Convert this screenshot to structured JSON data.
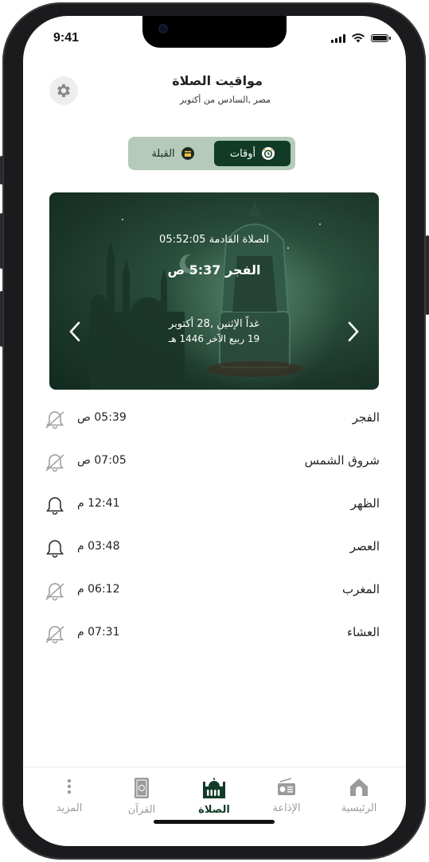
{
  "status": {
    "time": "9:41"
  },
  "header": {
    "title": "مواقيت الصلاة",
    "subtitle": "مصر ,السادس من أكتوبر"
  },
  "toggle": {
    "active_label": "أوقات",
    "inactive_label": "القبلة"
  },
  "banner": {
    "next_prayer": "الصلاة القادمة 05:52:05",
    "prayer_name": "الفجر",
    "prayer_time": "5:37 ص",
    "gregorian_date": "غداً الإثنين ,28 أكتوبر",
    "hijri_date": "19 ربيع الآخر 1446 هـ"
  },
  "prayers": [
    {
      "name": "الفجر",
      "time": "05:39 ص",
      "notify": false
    },
    {
      "name": "شروق الشمس",
      "time": "07:05 ص",
      "notify": false
    },
    {
      "name": "الظهر",
      "time": "12:41 م",
      "notify": true
    },
    {
      "name": "العصر",
      "time": "03:48 م",
      "notify": true
    },
    {
      "name": "المغرب",
      "time": "06:12 م",
      "notify": false
    },
    {
      "name": "العشاء",
      "time": "07:31 م",
      "notify": false
    }
  ],
  "tabs": {
    "home": "الرئيسية",
    "radio": "الإذاعة",
    "prayer": "الصلاة",
    "quran": "القرآن",
    "more": "المزيد"
  },
  "colors": {
    "accent": "#113b26",
    "toggle_bg": "#b5cabb",
    "inactive": "#9b9b9b"
  }
}
